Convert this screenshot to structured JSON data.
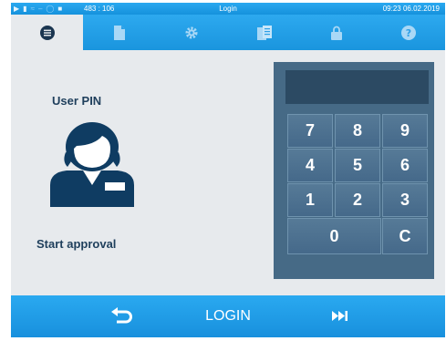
{
  "status_bar": {
    "counter": "483 : 106",
    "title": "Login",
    "datetime": "09:23  06.02.2019"
  },
  "tabs": [
    {
      "icon": "list-icon",
      "active": true
    },
    {
      "icon": "document-icon",
      "active": false
    },
    {
      "icon": "gear-icon",
      "active": false
    },
    {
      "icon": "logbook-icon",
      "active": false
    },
    {
      "icon": "lock-icon",
      "active": false
    },
    {
      "icon": "help-icon",
      "active": false
    }
  ],
  "main": {
    "pin_label": "User PIN",
    "approval_label": "Start approval",
    "pin_value": ""
  },
  "keypad": {
    "keys": [
      "7",
      "8",
      "9",
      "4",
      "5",
      "6",
      "1",
      "2",
      "3",
      "0",
      "C"
    ]
  },
  "bottom_bar": {
    "title": "LOGIN",
    "back_icon": "back-arrow-icon",
    "next_icon": "skip-forward-icon"
  },
  "colors": {
    "bar_blue": "#1d9be6",
    "content_bg": "#e7eaed",
    "keypad_bg": "#466a86",
    "text_dark": "#1f3f5c"
  }
}
